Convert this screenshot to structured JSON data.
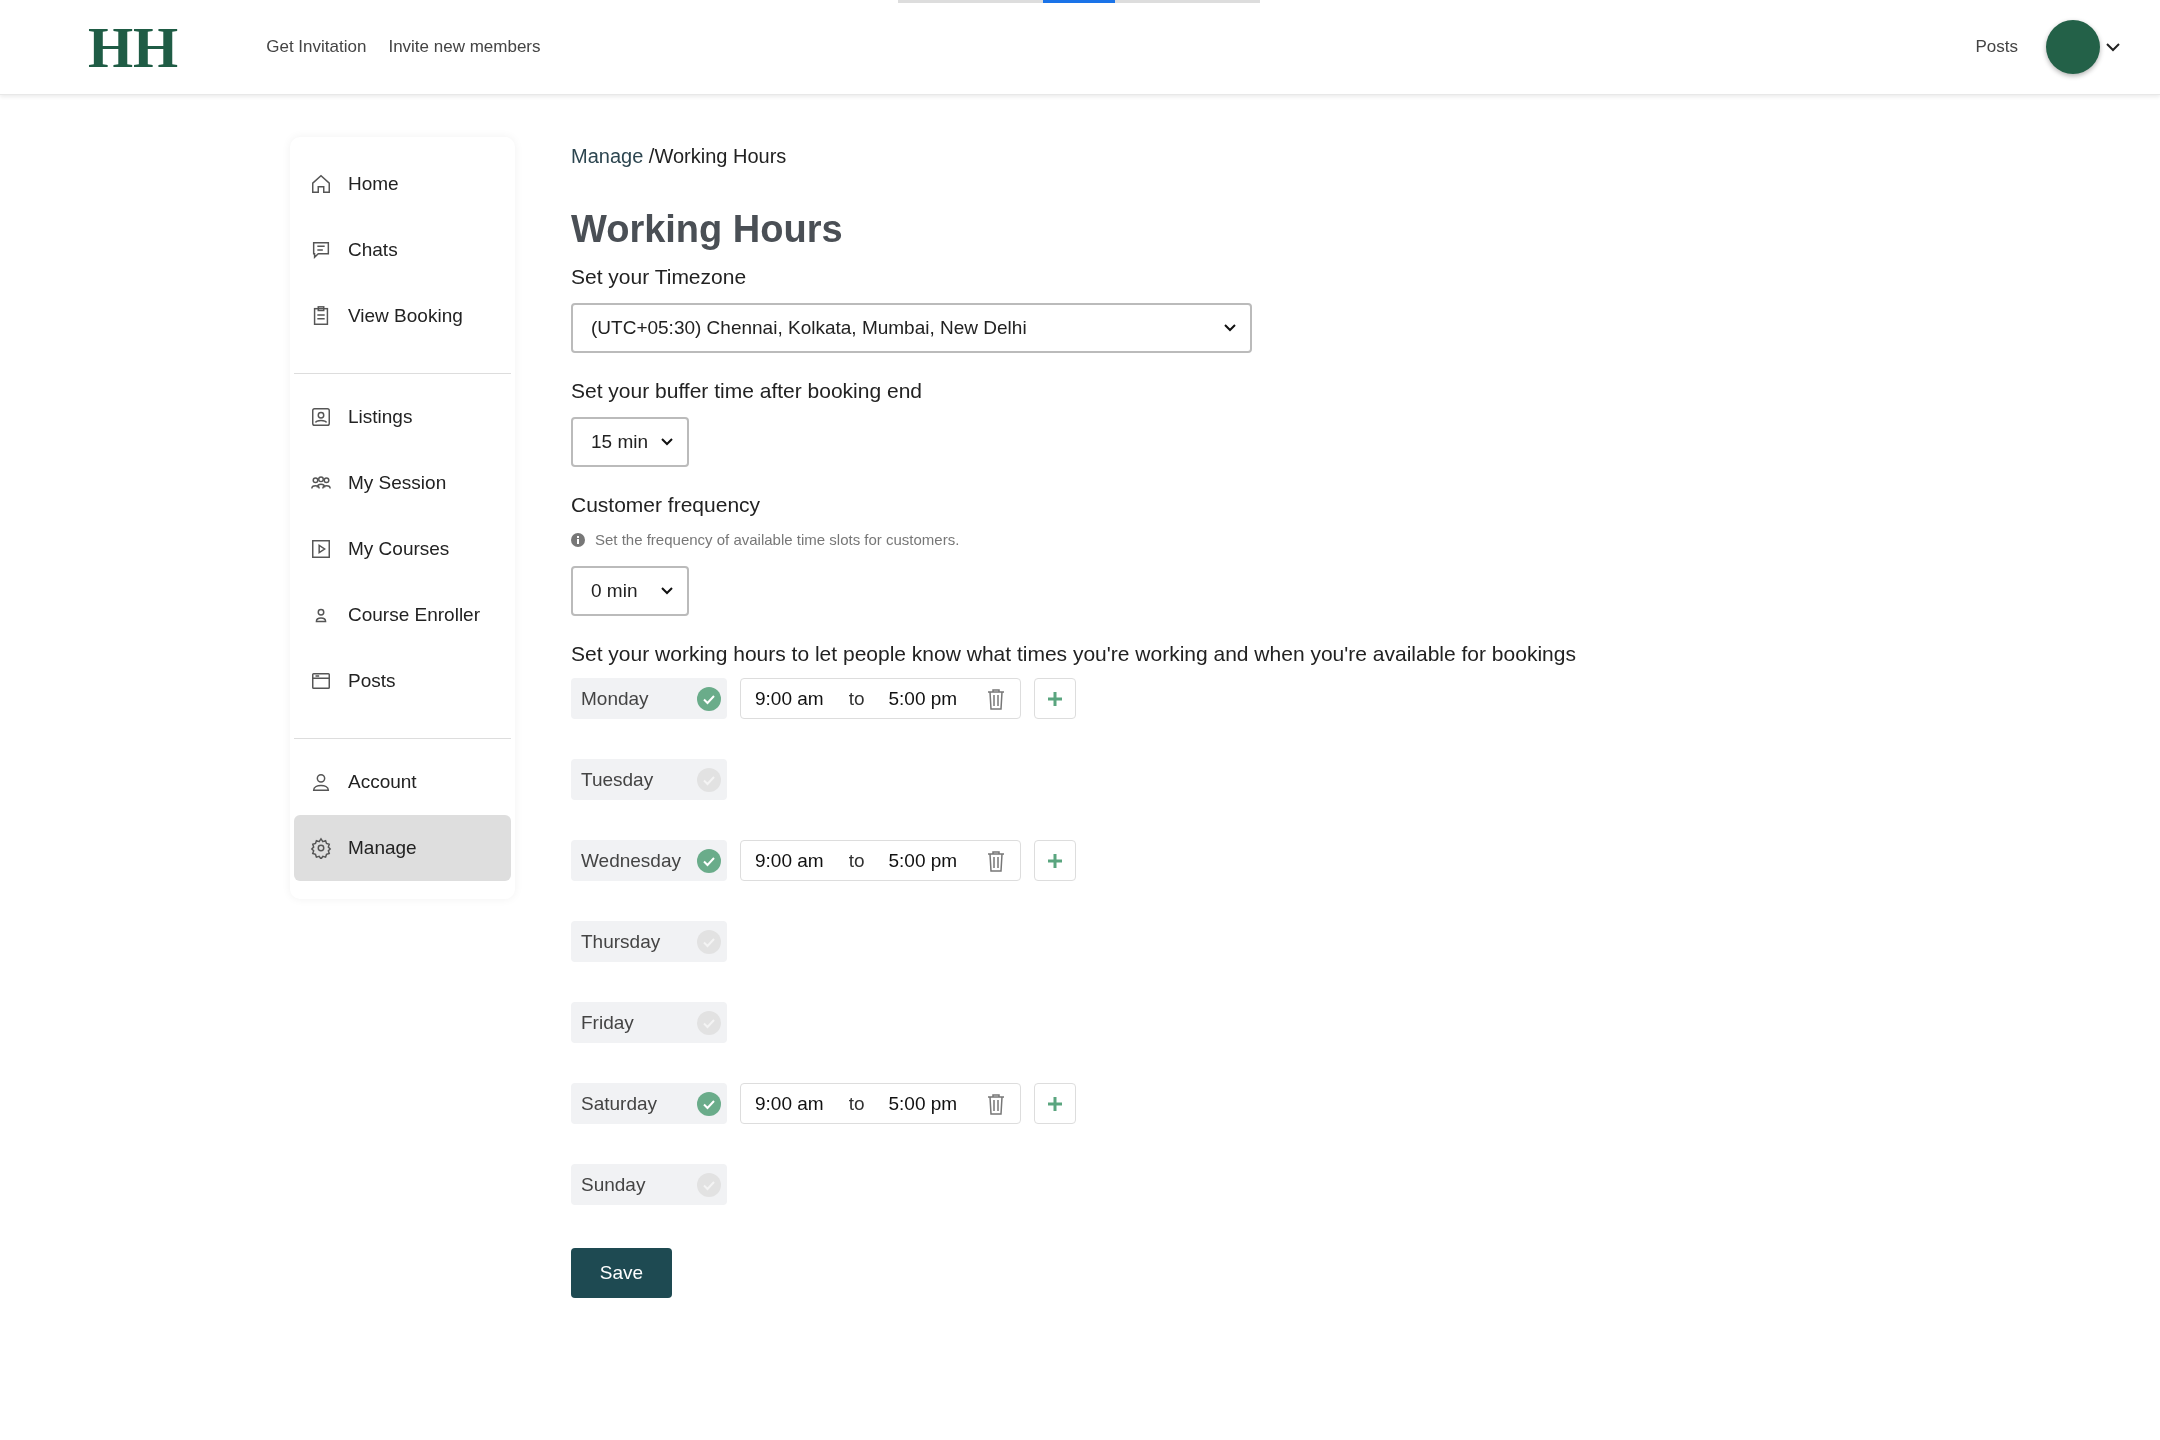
{
  "header": {
    "logo": "HH",
    "nav": [
      "Get Invitation",
      "Invite new members"
    ],
    "posts_link": "Posts"
  },
  "sidebar": {
    "groups": [
      [
        {
          "label": "Home",
          "kind": "home",
          "selected": false
        },
        {
          "label": "Chats",
          "kind": "chat",
          "selected": false
        },
        {
          "label": "View Booking",
          "kind": "clipboard",
          "selected": false
        }
      ],
      [
        {
          "label": "Listings",
          "kind": "listing",
          "selected": false
        },
        {
          "label": "My Session",
          "kind": "group",
          "selected": false
        },
        {
          "label": "My Courses",
          "kind": "play",
          "selected": false
        },
        {
          "label": "Course Enroller",
          "kind": "user-small",
          "selected": false
        },
        {
          "label": "Posts",
          "kind": "posts",
          "selected": false
        }
      ],
      [
        {
          "label": "Account",
          "kind": "user",
          "selected": false
        },
        {
          "label": "Manage",
          "kind": "gear",
          "selected": true
        }
      ]
    ]
  },
  "breadcrumb": {
    "parent": "Manage ",
    "current": "/Working Hours"
  },
  "title": "Working Hours",
  "timezone": {
    "label": "Set your Timezone",
    "value": "(UTC+05:30) Chennai, Kolkata, Mumbai, New Delhi"
  },
  "buffer": {
    "label": "Set your buffer time after booking end",
    "value": "15 min"
  },
  "frequency": {
    "label": "Customer frequency",
    "hint": "Set the frequency of available time slots for customers.",
    "value": "0 min"
  },
  "hours_intro": "Set your working hours to let people know what times you're working and when you're available for bookings",
  "days": [
    {
      "name": "Monday",
      "checked": true,
      "start": "9:00 am",
      "separator": "to",
      "end": "5:00 pm"
    },
    {
      "name": "Tuesday",
      "checked": false
    },
    {
      "name": "Wednesday",
      "checked": true,
      "start": "9:00 am",
      "separator": "to",
      "end": "5:00 pm"
    },
    {
      "name": "Thursday",
      "checked": false
    },
    {
      "name": "Friday",
      "checked": false
    },
    {
      "name": "Saturday",
      "checked": true,
      "start": "9:00 am",
      "separator": "to",
      "end": "5:00 pm"
    },
    {
      "name": "Sunday",
      "checked": false
    }
  ],
  "save_button": "Save"
}
